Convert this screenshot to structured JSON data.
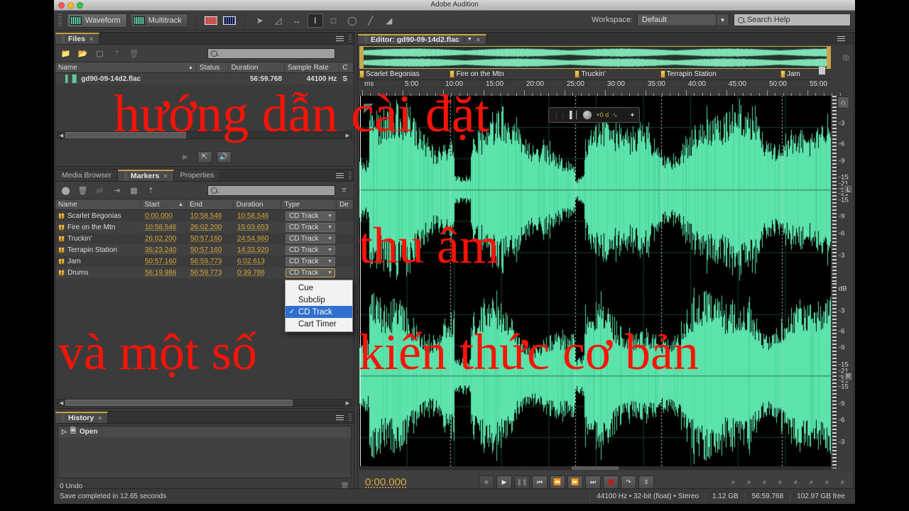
{
  "window": {
    "title": "Adobe Audition"
  },
  "toolbar": {
    "waveform_label": "Waveform",
    "multitrack_label": "Multitrack",
    "workspace_label": "Workspace:",
    "workspace_value": "Default",
    "search_help_placeholder": "Search Help",
    "icons": [
      "move-tool-icon",
      "slip-tool-icon",
      "time-selection-icon",
      "razor-icon",
      "marquee-icon",
      "lasso-icon",
      "paintbrush-icon",
      "spot-healing-icon"
    ]
  },
  "files_panel": {
    "tab": "Files",
    "close_glyph": "×",
    "search_placeholder": "",
    "columns": [
      "Name",
      "Status",
      "Duration",
      "Sample Rate",
      "C"
    ],
    "rows": [
      {
        "name": "gd90-09-14d2.flac",
        "status": "",
        "duration": "56:59.768",
        "sample_rate": "44100 Hz",
        "c": "S"
      }
    ]
  },
  "markers_panel": {
    "tabs": [
      "Media Browser",
      "Markers",
      "Properties"
    ],
    "active_tab": "Markers",
    "columns": [
      "Name",
      "Start",
      "End",
      "Duration",
      "Type",
      "De"
    ],
    "rows": [
      {
        "name": "Scarlet Begonias",
        "start": "0:00.000",
        "end": "10:58.546",
        "duration": "10:58.546",
        "type": "CD Track"
      },
      {
        "name": "Fire on the Mtn",
        "start": "10:58.546",
        "end": "26:02.200",
        "duration": "15:03.653",
        "type": "CD Track"
      },
      {
        "name": "Truckin'",
        "start": "26:02.200",
        "end": "50:57.160",
        "duration": "24:54.960",
        "type": "CD Track"
      },
      {
        "name": "Terrapin Station",
        "start": "36:23.240",
        "end": "50:57.160",
        "duration": "14:33.920",
        "type": "CD Track"
      },
      {
        "name": "Jam",
        "start": "50:57.160",
        "end": "56:59.773",
        "duration": "6:02.613",
        "type": "CD Track"
      },
      {
        "name": "Drums",
        "start": "56:19.986",
        "end": "56:59.773",
        "duration": "0:39.786",
        "type": "CD Track"
      }
    ]
  },
  "type_dropdown": {
    "items": [
      "Cue",
      "Subclip",
      "CD Track",
      "Cart Timer"
    ],
    "selected": "CD Track",
    "check_glyph": "✓"
  },
  "history_panel": {
    "tab": "History",
    "items": [
      "Open"
    ],
    "undo_label": "0 Undo"
  },
  "editor": {
    "tab": "Editor: gd90-09-14d2.flac",
    "markers": [
      {
        "label": "Scarlet Begonias",
        "pos_pct": 0.0
      },
      {
        "label": "Fire on the Mtn",
        "pos_pct": 19.2
      },
      {
        "label": "Truckin'",
        "pos_pct": 45.7
      },
      {
        "label": "Terrapin Station",
        "pos_pct": 63.8
      },
      {
        "label": "Jam",
        "pos_pct": 89.3
      }
    ],
    "time_ticks": [
      "ms",
      "5:00",
      "10:00",
      "15:00",
      "20:00",
      "25:00",
      "30:00",
      "35:00",
      "40:00",
      "45:00",
      "50:00",
      "55:00"
    ],
    "db_scale": [
      "dB",
      "-3",
      "-6",
      "-9",
      "-15",
      "-21",
      "-∞",
      "-21",
      "-15",
      "-9",
      "-6",
      "-3"
    ],
    "channel_labels": [
      "L",
      "R"
    ],
    "hud_value": "+0 d",
    "transport": {
      "time": "0:00.000",
      "buttons": [
        "stop-button",
        "play-button",
        "pause-button",
        "skip-start-button",
        "rewind-button",
        "fast-forward-button",
        "skip-end-button",
        "record-button",
        "loop-button",
        "waveform-toggle-button"
      ],
      "zoom_buttons": [
        "zoom-in-amplitude",
        "zoom-out-amplitude",
        "zoom-in-time",
        "zoom-out-time",
        "zoom-out-full",
        "zoom-to-selection-in",
        "zoom-to-selection-out",
        "zoom-to-selection"
      ]
    }
  },
  "status_bar": {
    "message": "Save completed in 12.65 seconds",
    "format": "44100 Hz • 32-bit (float) • Stereo",
    "size": "1.12 GB",
    "duration": "56:59.768",
    "free_space": "102.97 GB free"
  },
  "overlay": {
    "line1": "hướng dẫn cài đặt",
    "line2": "thu âm",
    "line3a": "và một số",
    "line3b": "kiến thức cơ bản",
    "color": "#fb1307"
  }
}
